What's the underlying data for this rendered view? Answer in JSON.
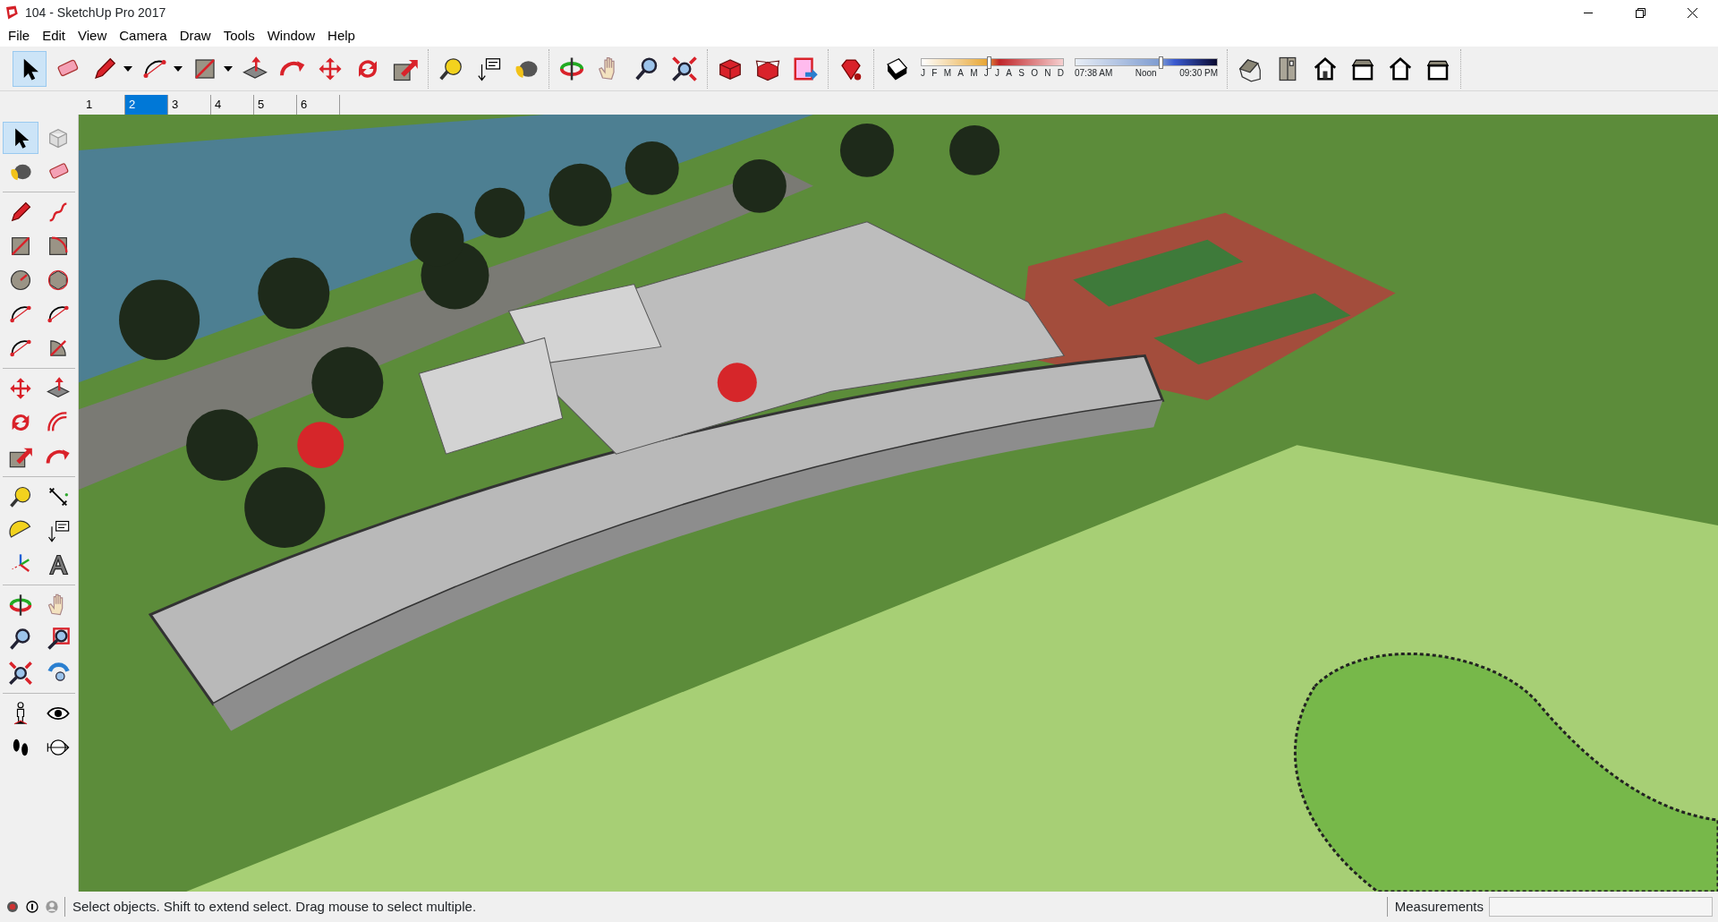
{
  "window": {
    "title": "104 - SketchUp Pro 2017"
  },
  "menu": [
    "File",
    "Edit",
    "View",
    "Camera",
    "Draw",
    "Tools",
    "Window",
    "Help"
  ],
  "toolbar": {
    "groups": [
      {
        "tools": [
          {
            "kind": "select",
            "selected": true,
            "dropdown": false
          },
          {
            "kind": "eraser",
            "selected": false,
            "dropdown": false
          },
          {
            "kind": "pencil",
            "selected": false,
            "dropdown": true
          },
          {
            "kind": "arc",
            "selected": false,
            "dropdown": true
          },
          {
            "kind": "rectangle",
            "selected": false,
            "dropdown": true
          },
          {
            "kind": "pushpull",
            "selected": false,
            "dropdown": false
          },
          {
            "kind": "followme",
            "selected": false,
            "dropdown": false
          },
          {
            "kind": "move",
            "selected": false,
            "dropdown": false
          },
          {
            "kind": "rotate",
            "selected": false,
            "dropdown": false
          },
          {
            "kind": "scale",
            "selected": false,
            "dropdown": false
          }
        ]
      },
      {
        "tools": [
          {
            "kind": "tape",
            "selected": false,
            "dropdown": false
          },
          {
            "kind": "text",
            "selected": false,
            "dropdown": false
          },
          {
            "kind": "paint",
            "selected": false,
            "dropdown": false
          }
        ]
      },
      {
        "tools": [
          {
            "kind": "orbit",
            "selected": false,
            "dropdown": false
          },
          {
            "kind": "pan",
            "selected": false,
            "dropdown": false
          },
          {
            "kind": "zoom",
            "selected": false,
            "dropdown": false
          },
          {
            "kind": "zoomext",
            "selected": false,
            "dropdown": false
          }
        ]
      },
      {
        "tools": [
          {
            "kind": "warehouse",
            "selected": false,
            "dropdown": false
          },
          {
            "kind": "extension",
            "selected": false,
            "dropdown": false
          },
          {
            "kind": "sendlayout",
            "selected": false,
            "dropdown": false
          }
        ]
      },
      {
        "tools": [
          {
            "kind": "ruby",
            "selected": false,
            "dropdown": false
          }
        ]
      }
    ]
  },
  "shadows": {
    "date_slider": {
      "level": 0.46,
      "labels": [
        "J",
        "F",
        "M",
        "A",
        "M",
        "J",
        "J",
        "A",
        "S",
        "O",
        "N",
        "D"
      ]
    },
    "time_slider": {
      "level": 0.59,
      "labels": [
        "07:38 AM",
        "Noon",
        "09:30 PM"
      ]
    }
  },
  "views": [
    {
      "kind": "iso"
    },
    {
      "kind": "top"
    },
    {
      "kind": "front"
    },
    {
      "kind": "right"
    },
    {
      "kind": "back"
    },
    {
      "kind": "left"
    }
  ],
  "scenes": [
    {
      "label": "1",
      "selected": false
    },
    {
      "label": "2",
      "selected": true
    },
    {
      "label": "3",
      "selected": false
    },
    {
      "label": "4",
      "selected": false
    },
    {
      "label": "5",
      "selected": false
    },
    {
      "label": "6",
      "selected": false
    }
  ],
  "left_toolbar": {
    "groups": [
      {
        "tools": [
          {
            "kind": "select",
            "selected": true
          },
          {
            "kind": "component",
            "selected": false
          },
          {
            "kind": "paint",
            "selected": false
          },
          {
            "kind": "eraser",
            "selected": false
          }
        ]
      },
      {
        "tools": [
          {
            "kind": "pencil",
            "selected": false
          },
          {
            "kind": "freehand",
            "selected": false
          },
          {
            "kind": "rectangle",
            "selected": false
          },
          {
            "kind": "rotrect",
            "selected": false
          },
          {
            "kind": "circle",
            "selected": false
          },
          {
            "kind": "polygon",
            "selected": false
          },
          {
            "kind": "arc",
            "selected": false
          },
          {
            "kind": "arc",
            "selected": false
          },
          {
            "kind": "arc",
            "selected": false
          },
          {
            "kind": "pie",
            "selected": false
          }
        ]
      },
      {
        "tools": [
          {
            "kind": "move",
            "selected": false
          },
          {
            "kind": "pushpull",
            "selected": false
          },
          {
            "kind": "rotate",
            "selected": false
          },
          {
            "kind": "offset",
            "selected": false
          },
          {
            "kind": "scale",
            "selected": false
          },
          {
            "kind": "followme",
            "selected": false
          }
        ]
      },
      {
        "tools": [
          {
            "kind": "tape",
            "selected": false
          },
          {
            "kind": "dimension",
            "selected": false
          },
          {
            "kind": "protractor",
            "selected": false
          },
          {
            "kind": "text",
            "selected": false
          },
          {
            "kind": "axes",
            "selected": false
          },
          {
            "kind": "text3d",
            "selected": false
          }
        ]
      },
      {
        "tools": [
          {
            "kind": "orbit",
            "selected": false
          },
          {
            "kind": "pan",
            "selected": false
          },
          {
            "kind": "zoom",
            "selected": false
          },
          {
            "kind": "zoomwindow",
            "selected": false
          },
          {
            "kind": "zoomext",
            "selected": false
          },
          {
            "kind": "previous",
            "selected": false
          }
        ]
      },
      {
        "tools": [
          {
            "kind": "position",
            "selected": false
          },
          {
            "kind": "lookaround",
            "selected": false
          },
          {
            "kind": "walk",
            "selected": false
          },
          {
            "kind": "section",
            "selected": false
          }
        ]
      }
    ]
  },
  "status_bar": {
    "message": "Select objects. Shift to extend select. Drag mouse to select multiple.",
    "measurements_label": "Measurements"
  }
}
